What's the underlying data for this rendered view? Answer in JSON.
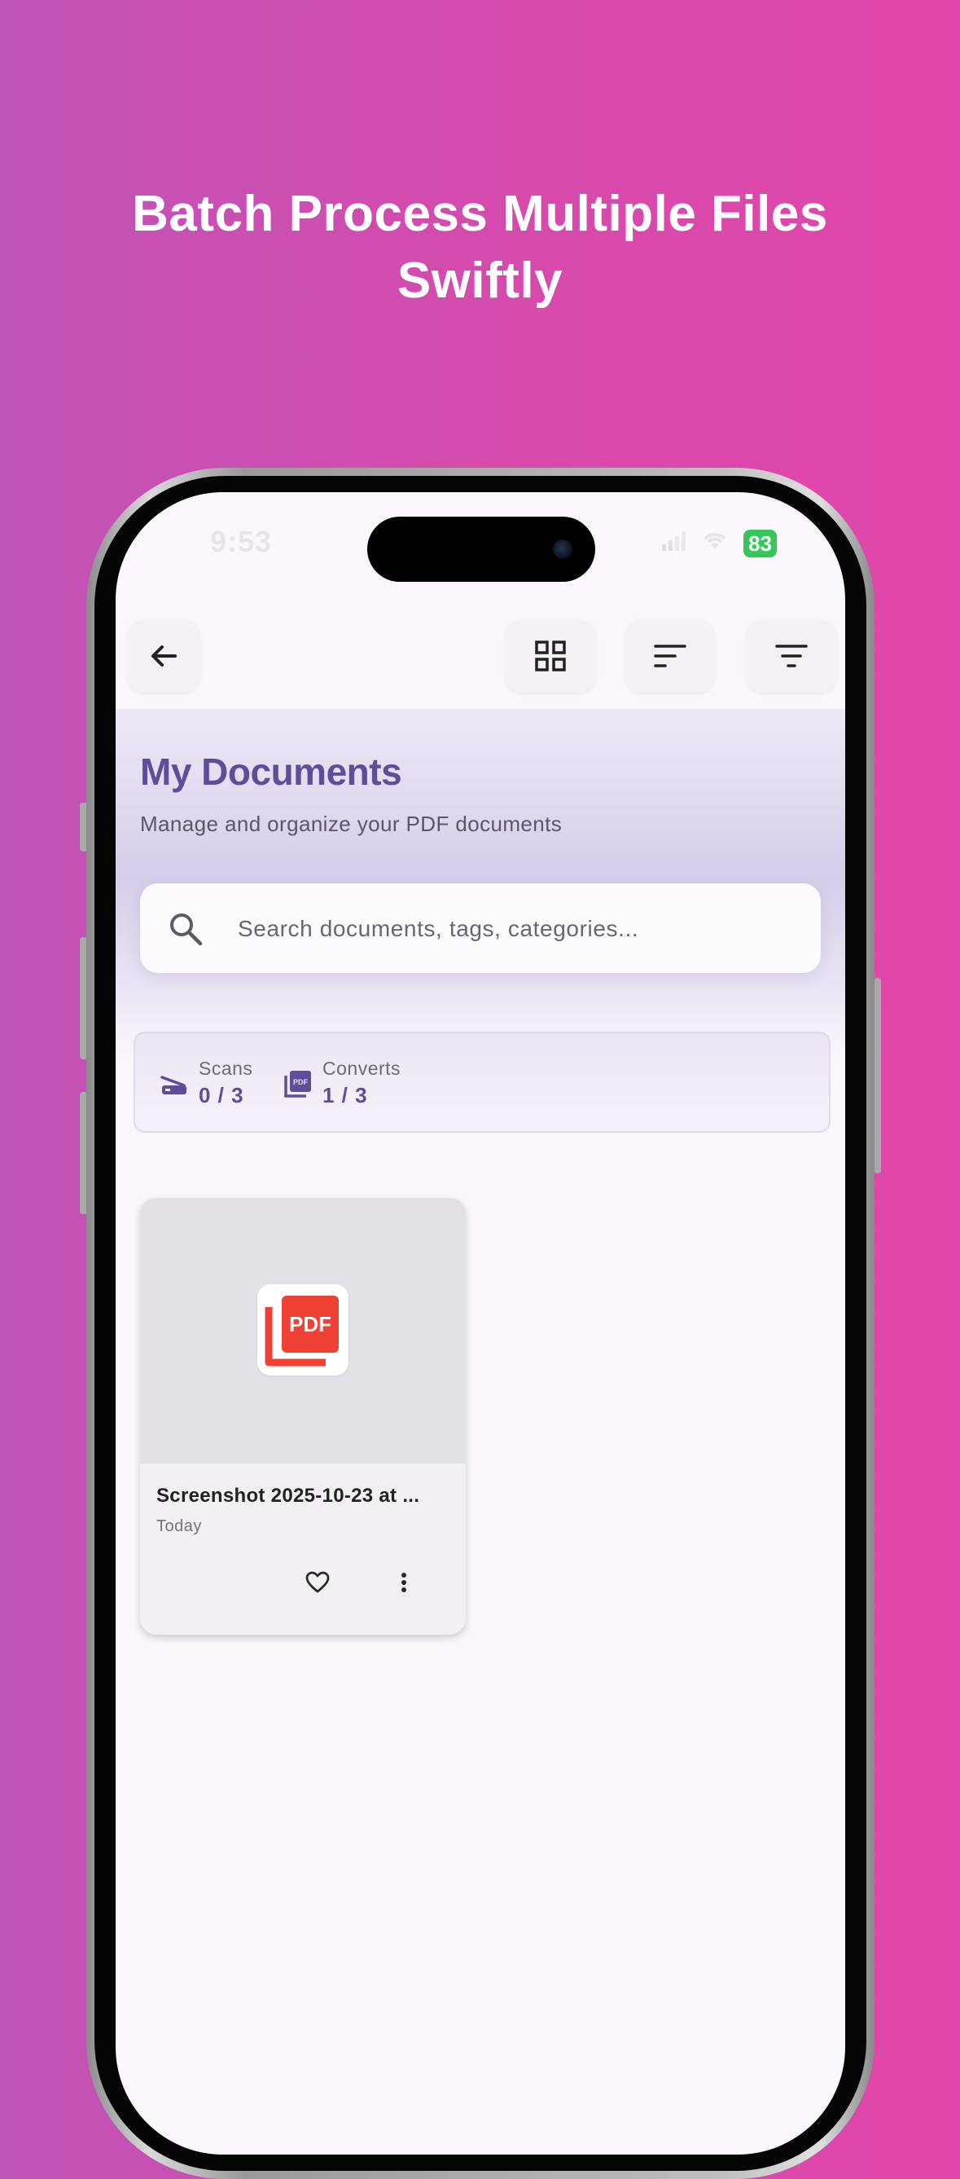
{
  "headline": {
    "line1": "Batch Process Multiple Files",
    "line2": "Swiftly"
  },
  "status_bar": {
    "time": "9:53",
    "battery": "83"
  },
  "appbar": {
    "icons": [
      "arrow-back-icon",
      "grid-view-icon",
      "sort-icon",
      "filter-icon"
    ]
  },
  "header": {
    "title": "My Documents",
    "subtitle": "Manage and organize your PDF documents"
  },
  "search": {
    "placeholder": "Search documents, tags, categories...",
    "value": ""
  },
  "quota": {
    "scans": {
      "label": "Scans",
      "value": "0 / 3",
      "icon": "scanner-icon"
    },
    "converts": {
      "label": "Converts",
      "value": "1 / 3",
      "icon": "pdf-convert-icon"
    }
  },
  "documents": [
    {
      "name": "Screenshot 2025-10-23 at ...",
      "date": "Today",
      "badge": "PDF",
      "favorite": false
    }
  ],
  "colors": {
    "accent": "#5e4e9a",
    "pdf_red": "#ef4136",
    "background_gradient_start": "#c053b6",
    "background_gradient_end": "#e146a8"
  }
}
